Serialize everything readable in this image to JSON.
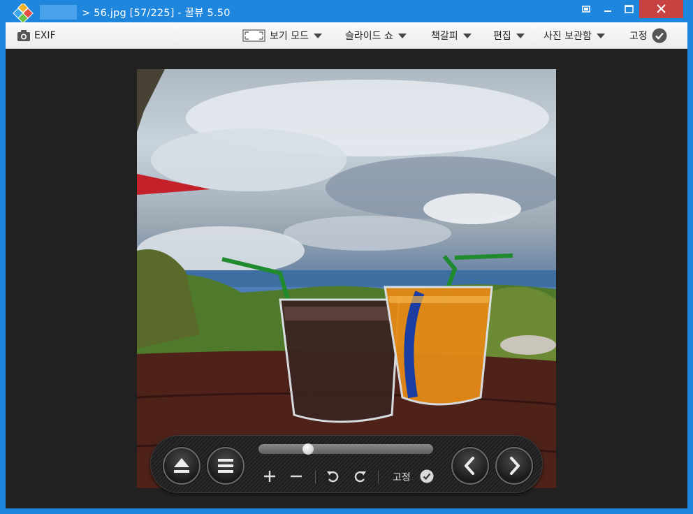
{
  "window": {
    "title": "> 56.jpg [57/225] - 꿀뷰 5.50",
    "file_name": "56.jpg",
    "position": "57/225",
    "app_name": "꿀뷰",
    "version": "5.50"
  },
  "menubar": {
    "exif_label": "EXIF",
    "items": [
      {
        "label": "보기 모드",
        "icon": "fit-screen-icon"
      },
      {
        "label": "슬라이드 쇼"
      },
      {
        "label": "책갈피"
      },
      {
        "label": "편집"
      },
      {
        "label": "사진 보관함"
      }
    ],
    "pin_label": "고정"
  },
  "controls": {
    "pin_label": "고정",
    "slider_position": 0.27,
    "icons": [
      "eject-icon",
      "menu-icon",
      "zoom-in-icon",
      "zoom-out-icon",
      "rotate-left-icon",
      "rotate-right-icon",
      "check-icon",
      "previous-icon",
      "next-icon"
    ]
  },
  "colors": {
    "titlebar": "#1f86dd",
    "close": "#c74240",
    "viewer_bg": "#212121"
  }
}
